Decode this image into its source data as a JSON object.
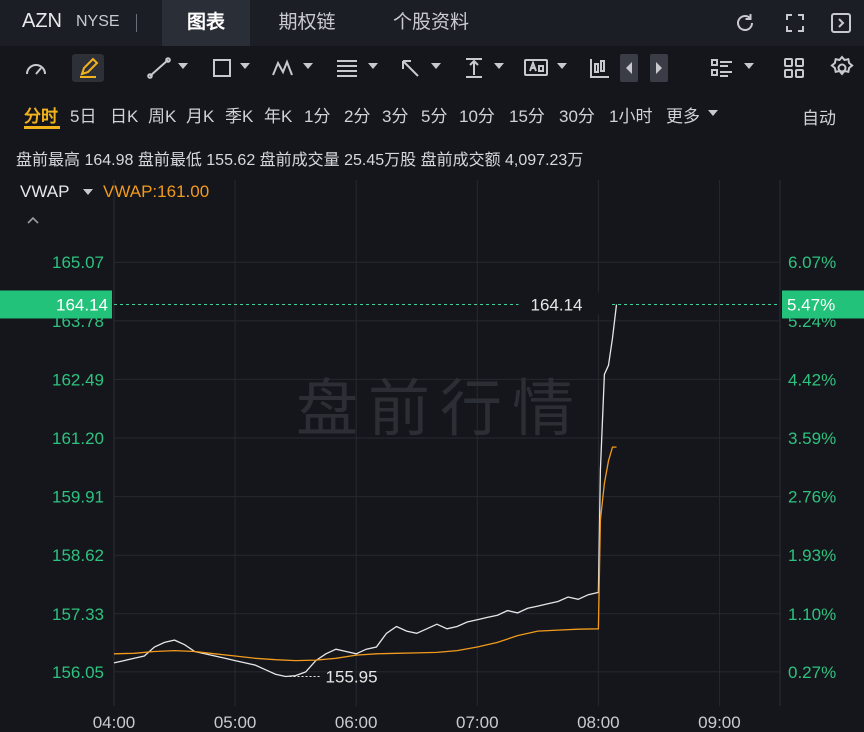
{
  "header": {
    "ticker": "AZN",
    "exchange": "NYSE",
    "tabs": [
      {
        "label": "图表",
        "active": true
      },
      {
        "label": "期权链",
        "active": false
      },
      {
        "label": "个股资料",
        "active": false
      }
    ],
    "icons": [
      "refresh-icon",
      "fullscreen-icon",
      "exit-panel-icon"
    ]
  },
  "toolbar": {
    "tools": [
      "speed-gauge-icon",
      "pen-draw-icon",
      "line-tool-icon",
      "rectangle-tool-icon",
      "wave-pattern-icon",
      "fibonacci-tool-icon",
      "arrow-tool-icon",
      "vertical-measure-icon",
      "text-annotation-icon",
      "candle-tool-icon",
      "prev-arrow-icon",
      "next-arrow-icon",
      "list-layout-icon",
      "grid-layout-icon",
      "settings-gear-icon"
    ]
  },
  "periods": {
    "items": [
      "分时",
      "5日",
      "日K",
      "周K",
      "月K",
      "季K",
      "年K",
      "1分",
      "2分",
      "3分",
      "5分",
      "10分",
      "15分",
      "30分",
      "1小时",
      "更多"
    ],
    "active": "分时",
    "mode": "自动"
  },
  "premarket": {
    "line": "盘前最高 164.98 盘前最低 155.62 盘前成交量 25.45万股 盘前成交额 4,097.23万"
  },
  "indicator": {
    "name": "VWAP",
    "value_text": "VWAP:161.00"
  },
  "colors": {
    "price_line": "#e6e6e6",
    "vwap_line": "#f29a1c",
    "axis_text_green": "#2ec27e",
    "badge_green": "#23c27a",
    "accent": "#f2b21c"
  },
  "chart_data": {
    "type": "line",
    "watermark": "盘前行情",
    "x_ticks": [
      "04:00",
      "05:00",
      "06:00",
      "07:00",
      "08:00",
      "09:00"
    ],
    "x_range": [
      "04:00",
      "09:30"
    ],
    "y_ticks_left": [
      "165.07",
      "163.78",
      "162.49",
      "161.20",
      "159.91",
      "158.62",
      "157.33",
      "156.05"
    ],
    "y_ticks_right": [
      "6.07%",
      "5.24%",
      "4.42%",
      "3.59%",
      "2.76%",
      "1.93%",
      "1.10%",
      "0.27%"
    ],
    "y_range": [
      155.3,
      166.0
    ],
    "current_price": "164.14",
    "current_pct": "5.47%",
    "low_label": "155.95",
    "grid": true,
    "series": [
      {
        "name": "price",
        "x": [
          "04:00",
          "04:05",
          "04:10",
          "04:15",
          "04:20",
          "04:25",
          "04:30",
          "04:35",
          "04:40",
          "04:45",
          "04:50",
          "04:55",
          "05:00",
          "05:05",
          "05:10",
          "05:15",
          "05:20",
          "05:25",
          "05:30",
          "05:35",
          "05:40",
          "05:45",
          "05:50",
          "05:55",
          "06:00",
          "06:05",
          "06:10",
          "06:15",
          "06:20",
          "06:25",
          "06:30",
          "06:35",
          "06:40",
          "06:45",
          "06:50",
          "06:55",
          "07:00",
          "07:05",
          "07:10",
          "07:15",
          "07:20",
          "07:25",
          "07:30",
          "07:35",
          "07:40",
          "07:45",
          "07:50",
          "07:55",
          "08:00",
          "08:01",
          "08:03",
          "08:05",
          "08:07",
          "08:09"
        ],
        "values": [
          156.25,
          156.3,
          156.35,
          156.4,
          156.6,
          156.7,
          156.75,
          156.65,
          156.5,
          156.45,
          156.4,
          156.35,
          156.3,
          156.25,
          156.2,
          156.1,
          156.0,
          155.95,
          155.97,
          156.05,
          156.3,
          156.45,
          156.55,
          156.5,
          156.45,
          156.55,
          156.6,
          156.9,
          157.05,
          156.95,
          156.9,
          157.0,
          157.1,
          157.0,
          157.05,
          157.15,
          157.2,
          157.25,
          157.3,
          157.4,
          157.35,
          157.45,
          157.5,
          157.55,
          157.6,
          157.7,
          157.65,
          157.75,
          157.8,
          160.5,
          162.6,
          162.8,
          163.4,
          164.14
        ]
      },
      {
        "name": "VWAP",
        "x": [
          "04:00",
          "04:10",
          "04:20",
          "04:30",
          "04:40",
          "04:50",
          "05:00",
          "05:10",
          "05:20",
          "05:30",
          "05:40",
          "05:50",
          "06:00",
          "06:10",
          "06:20",
          "06:30",
          "06:40",
          "06:50",
          "07:00",
          "07:10",
          "07:20",
          "07:30",
          "07:40",
          "07:50",
          "08:00",
          "08:01",
          "08:03",
          "08:05",
          "08:07",
          "08:09"
        ],
        "values": [
          156.45,
          156.46,
          156.5,
          156.52,
          156.5,
          156.45,
          156.4,
          156.35,
          156.32,
          156.3,
          156.31,
          156.35,
          156.42,
          156.45,
          156.46,
          156.47,
          156.48,
          156.52,
          156.6,
          156.7,
          156.85,
          156.95,
          156.97,
          156.99,
          157.0,
          159.4,
          160.2,
          160.7,
          161.0,
          161.0
        ]
      }
    ]
  }
}
